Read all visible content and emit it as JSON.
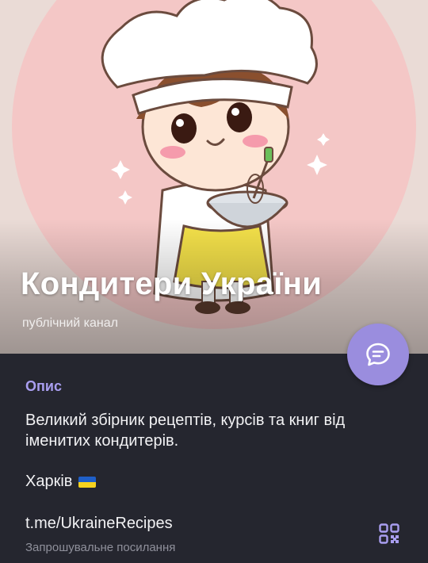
{
  "channel": {
    "title": "Кондитери України",
    "subtitle": "публічний канал"
  },
  "fab": {
    "icon": "chat-bubble-icon"
  },
  "info": {
    "section_label": "Опис",
    "description": "Великий збірник рецептів, курсів та книг від іменитих кондитерів.",
    "city": "Харків",
    "flag_icon": "ukraine-flag-icon",
    "link": "t.me/UkraineRecipes",
    "link_caption": "Запрошувальне посилання",
    "qr_icon": "qr-code-icon"
  },
  "colors": {
    "accent": "#9a8dde",
    "section_label": "#a99ef0",
    "background": "#25262f",
    "flag_blue": "#1f5fc8",
    "flag_yellow": "#f6d21f"
  }
}
